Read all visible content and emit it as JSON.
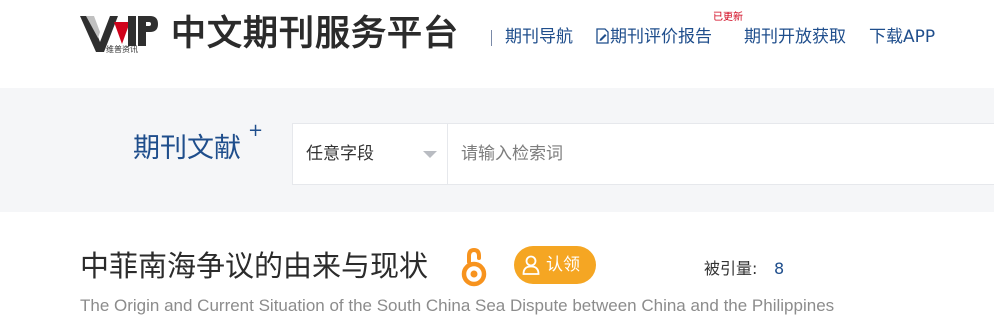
{
  "header": {
    "logo_text": "VIP",
    "logo_subtext": "维普资讯",
    "site_title": "中文期刊服务平台",
    "nav": [
      {
        "label": "期刊导航"
      },
      {
        "label": "期刊评价报告",
        "icon": "document-edit-icon"
      },
      {
        "label": "期刊开放获取",
        "badge": "已更新"
      },
      {
        "label": "下载APP"
      }
    ]
  },
  "search": {
    "scope_label": "期刊文献",
    "scope_plus": "+",
    "field_selected": "任意字段",
    "placeholder": "请输入检索词"
  },
  "article": {
    "title": "中菲南海争议的由来与现状",
    "open_access_icon": "open-access-icon",
    "claim_label": "认领",
    "cited_label": "被引量:",
    "cited_count": "8",
    "title_en": "The Origin and Current Situation of the South China Sea Dispute between China and the Philippines"
  },
  "colors": {
    "link_blue": "#1f4e8c",
    "claim_orange": "#f5a623",
    "open_access_orange": "#f7931e",
    "new_badge_red": "#d0021b",
    "band_gray": "#f5f6f8"
  }
}
